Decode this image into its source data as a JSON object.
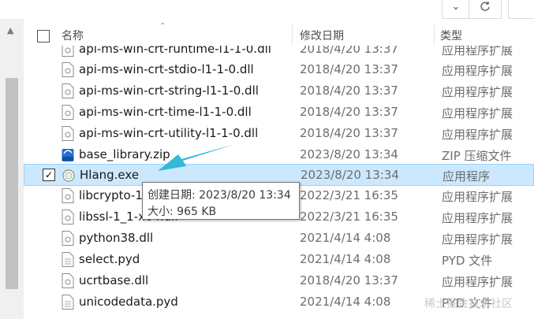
{
  "columns": {
    "name": "名称",
    "date": "修改日期",
    "type": "类型"
  },
  "files": [
    {
      "name": "api-ms-win-crt-runtime-l1-1-0.dll",
      "date": "2018/4/20 13:37",
      "type": "应用程序扩展",
      "icon": "dll-file-icon"
    },
    {
      "name": "api-ms-win-crt-stdio-l1-1-0.dll",
      "date": "2018/4/20 13:37",
      "type": "应用程序扩展",
      "icon": "dll-file-icon"
    },
    {
      "name": "api-ms-win-crt-string-l1-1-0.dll",
      "date": "2018/4/20 13:37",
      "type": "应用程序扩展",
      "icon": "dll-file-icon"
    },
    {
      "name": "api-ms-win-crt-time-l1-1-0.dll",
      "date": "2018/4/20 13:37",
      "type": "应用程序扩展",
      "icon": "dll-file-icon"
    },
    {
      "name": "api-ms-win-crt-utility-l1-1-0.dll",
      "date": "2018/4/20 13:37",
      "type": "应用程序扩展",
      "icon": "dll-file-icon"
    },
    {
      "name": "base_library.zip",
      "date": "2023/8/20 13:34",
      "type": "ZIP 压缩文件",
      "icon": "zip-file-icon"
    },
    {
      "name": "Hlang.exe",
      "date": "2023/8/20 13:34",
      "type": "应用程序",
      "icon": "exe-app-icon",
      "selected": true
    },
    {
      "name": "libcrypto-1",
      "date": "2022/3/21 16:35",
      "type": "应用程序扩展",
      "icon": "dll-file-icon"
    },
    {
      "name": "libssl-1_1-x64.dll",
      "date": "2022/3/21 16:35",
      "type": "应用程序扩展",
      "icon": "dll-file-icon"
    },
    {
      "name": "python38.dll",
      "date": "2021/4/14 4:08",
      "type": "应用程序扩展",
      "icon": "dll-file-icon"
    },
    {
      "name": "select.pyd",
      "date": "2021/4/14 4:08",
      "type": "PYD 文件",
      "icon": "file-icon"
    },
    {
      "name": "ucrtbase.dll",
      "date": "2018/4/20 13:37",
      "type": "应用程序扩展",
      "icon": "dll-file-icon"
    },
    {
      "name": "unicodedata.pyd",
      "date": "2021/4/14 4:08",
      "type": "PYD 文件",
      "icon": "file-icon"
    }
  ],
  "tooltip": {
    "created": "创建日期: 2023/8/20 13:34",
    "size": "大小: 965 KB"
  },
  "watermark": "稀土掘金技术社区",
  "colors": {
    "selection_bg": "#cce8ff",
    "selection_border": "#99d1ff",
    "annotation_arrow": "#35b8d6"
  }
}
